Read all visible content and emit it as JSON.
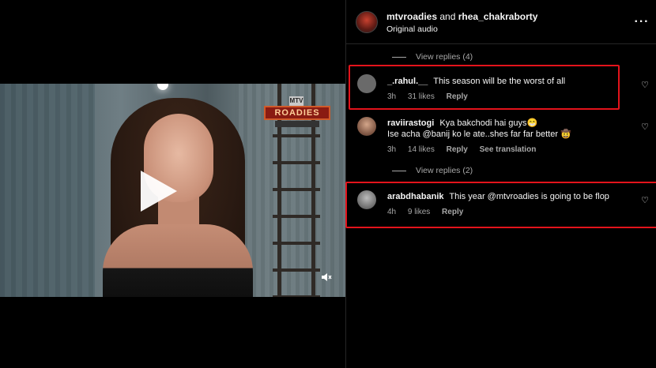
{
  "post": {
    "user1": "mtvroadies",
    "joiner": "and",
    "user2": "rhea_chakraborty",
    "audio": "Original audio",
    "more_icon": "more-horizontal-icon"
  },
  "video": {
    "logo_mtv": "MTV",
    "logo_word": "ROADIES",
    "play_icon": "play-icon",
    "mute_icon": "volume-muted-icon"
  },
  "replies_1": {
    "label": "View replies (4)"
  },
  "replies_2": {
    "label": "View replies (2)"
  },
  "comments": [
    {
      "username": "_.rahul.__",
      "text": "This season will be the worst of all",
      "time": "3h",
      "likes": "31 likes",
      "reply": "Reply"
    },
    {
      "username": "raviirastogi",
      "text": "Kya bakchodi hai guys😁",
      "text2": "Ise acha @banij ko le ate..shes far far better 🤠",
      "time": "3h",
      "likes": "14 likes",
      "reply": "Reply",
      "translate": "See translation"
    },
    {
      "username": "arabdhabanik",
      "text": "This year @mtvroadies is going to be flop",
      "time": "4h",
      "likes": "9 likes",
      "reply": "Reply"
    }
  ],
  "colors": {
    "highlight": "#e3131b",
    "secondary_text": "#a8a8a8",
    "background": "#000000"
  }
}
